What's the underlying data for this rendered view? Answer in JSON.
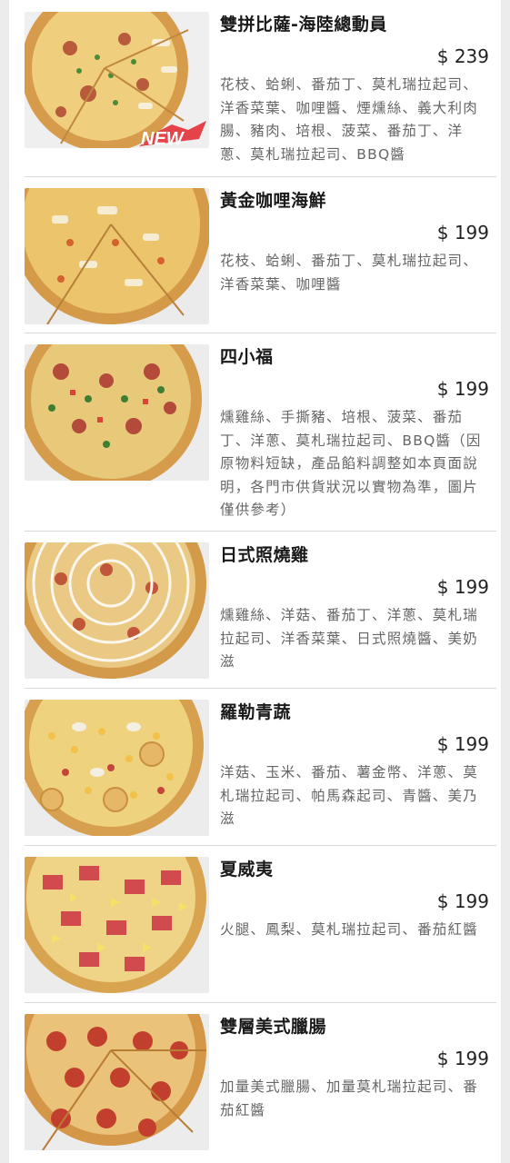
{
  "menu": [
    {
      "name": "雙拼比薩-海陸總動員",
      "price": "$ 239",
      "desc": "花枝、蛤蜊、番茄丁、莫札瑞拉起司、洋香菜葉、咖哩醬、煙燻絲、義大利肉腸、豬肉、培根、菠菜、番茄丁、洋蔥、莫札瑞拉起司、BBQ醬",
      "badge": "NEW",
      "image": "pizza-half-half"
    },
    {
      "name": "黃金咖哩海鮮",
      "price": "$ 199",
      "desc": "花枝、蛤蜊、番茄丁、莫札瑞拉起司、洋香菜葉、咖哩醬",
      "image": "pizza-golden-curry-seafood"
    },
    {
      "name": "四小福",
      "price": "$ 199",
      "desc": "燻雞絲、手撕豬、培根、菠菜、番茄丁、洋蔥、莫札瑞拉起司、BBQ醬（因原物料短缺，產品餡料調整如本頁面說明，各門市供貨狀況以實物為準，圖片僅供參考）",
      "image": "pizza-four-blessings"
    },
    {
      "name": "日式照燒雞",
      "price": "$ 199",
      "desc": "燻雞絲、洋菇、番茄丁、洋蔥、莫札瑞拉起司、洋香菜葉、日式照燒醬、美奶滋",
      "image": "pizza-teriyaki-chicken"
    },
    {
      "name": "羅勒青蔬",
      "price": "$ 199",
      "desc": "洋菇、玉米、番茄、薯金幣、洋蔥、莫札瑞拉起司、帕馬森起司、青醬、美乃滋",
      "image": "pizza-basil-veggie"
    },
    {
      "name": "夏威夷",
      "price": "$ 199",
      "desc": "火腿、鳳梨、莫札瑞拉起司、番茄紅醬",
      "image": "pizza-hawaiian"
    },
    {
      "name": "雙層美式臘腸",
      "price": "$ 199",
      "desc": "加量美式臘腸、加量莫札瑞拉起司、番茄紅醬",
      "image": "pizza-double-pepperoni"
    }
  ],
  "colors": {
    "badge_red": "#e0242b",
    "crust": "#d9a354",
    "cheese": "#f1d58c",
    "sauce": "#c9442e"
  }
}
